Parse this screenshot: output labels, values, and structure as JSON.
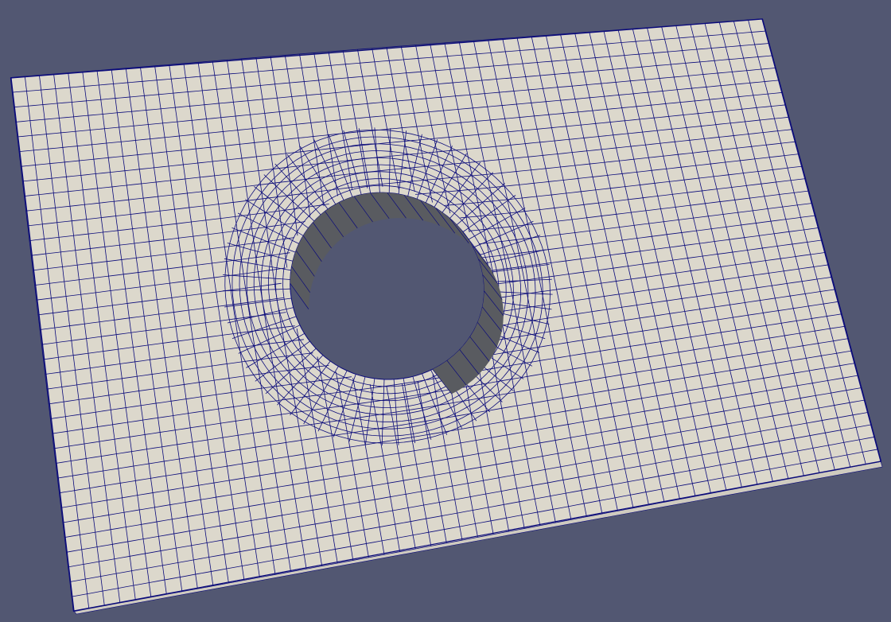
{
  "viewport": {
    "background_color": "#525772",
    "surface_color": "#dcd8cc",
    "mesh_edge_color": "#0b0b7a",
    "hole_wall_color": "#595b60",
    "side_face_color": "#cfcbbf"
  },
  "scene": {
    "object": "structured-quad-mesh-plate-with-circular-hole",
    "representation": "surface-with-edges"
  }
}
